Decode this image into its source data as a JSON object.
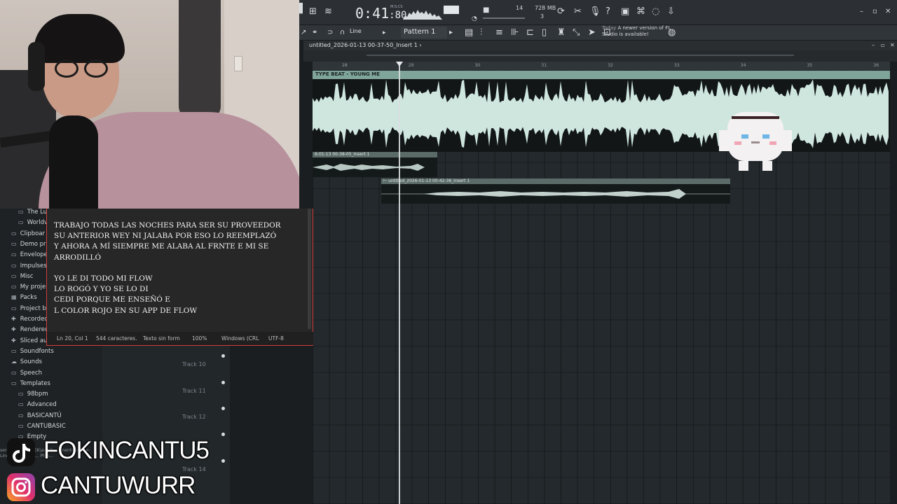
{
  "toolbar": {
    "time_main": "0:41",
    "time_frac": "80",
    "time_unit": "M:S:CS",
    "counter": "14",
    "memory": "728 MB",
    "cpu": "3",
    "snap_label": "Line",
    "pattern_label": "Pattern 1",
    "news_today": "Today",
    "news_text": "A newer version of FL Studio is available!"
  },
  "playlist": {
    "title": "untitled_2026-01-13 00-37-50_Insert 1",
    "ruler": [
      "28",
      "29",
      "30",
      "31",
      "32",
      "33",
      "34",
      "35",
      "36"
    ],
    "main_clip_label": "TYPE BEAT - YOUNG ME",
    "clip2_label": "6-01-13 00-38-05_Insert 1",
    "clip3_label": "untitled_2026-01-13 00-42-36_Insert 1",
    "tracks": [
      "Track 10",
      "Track 11",
      "Track 12",
      "Track 14"
    ]
  },
  "browser": {
    "items": [
      {
        "label": "The Lu",
        "icon": "folder-icon"
      },
      {
        "label": "Worldv",
        "icon": "folder-icon"
      },
      {
        "label": "Clipboar",
        "icon": "folder-icon"
      },
      {
        "label": "Demo pr",
        "icon": "folder-icon"
      },
      {
        "label": "Envelope",
        "icon": "folder-icon"
      },
      {
        "label": "Impulses",
        "icon": "folder-icon"
      },
      {
        "label": "Misc",
        "icon": "folder-icon"
      },
      {
        "label": "My proje",
        "icon": "folder-icon"
      },
      {
        "label": "Packs",
        "icon": "packs-icon"
      },
      {
        "label": "Project b",
        "icon": "folder-icon"
      },
      {
        "label": "Recorded",
        "icon": "plus-icon"
      },
      {
        "label": "Rendered",
        "icon": "plus-icon"
      },
      {
        "label": "Sliced au",
        "icon": "plus-icon"
      },
      {
        "label": "Soundfonts",
        "icon": "folder-icon"
      },
      {
        "label": "Sounds",
        "icon": "cloud-icon"
      },
      {
        "label": "Speech",
        "icon": "folder-icon"
      },
      {
        "label": "Templates",
        "icon": "folder-icon"
      },
      {
        "label": "98bpm",
        "icon": "folder-icon"
      },
      {
        "label": "Advanced",
        "icon": "folder-icon"
      },
      {
        "label": "BASICANTÚ",
        "icon": "folder-icon"
      },
      {
        "label": "CANTUBASIC",
        "icon": "folder-icon"
      },
      {
        "label": "Empty",
        "icon": "folder-icon"
      }
    ],
    "path": "sers\\CANTU\\ASTEK\\aw\\ Documents\\Image-Line\\FL St... Plug... PMA..."
  },
  "notepad": {
    "text": "TRABAJO TODAS LAS NOCHES PARA SER SU PROVEEDOR\nSU ANTERIOR WEY NI JALABA POR ESO LO REEMPLAZÓ\nY AHORA A MÍ SIEMPRE ME ALABA AL FRNTE E MI SE\nARRODILLÓ\n\nYO LE DI TODO MI FLOW\nLO ROGÓ Y YO SE LO DI\nCEDI PORQUE ME ENSEÑÓ E\nL COLOR ROJO EN SU APP DE FLOW",
    "status": {
      "position": "Ln 20, Col 1",
      "chars": "544 caracteres.",
      "format": "Texto sin form",
      "zoom": "100%",
      "eol": "Windows (CRL",
      "encoding": "UTF-8"
    }
  },
  "overlay": {
    "tiktok": "FOKINCANTU5",
    "instagram": "CANTUWURR"
  },
  "colors": {
    "accent": "#7fa59a",
    "notepad_border": "#d23b3b",
    "waveform": "#cfe6df"
  }
}
